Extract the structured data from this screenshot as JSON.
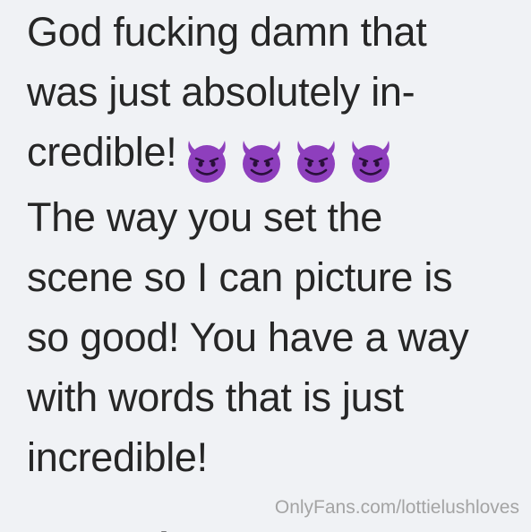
{
  "message": {
    "lines": [
      "God fucking damn that",
      "was just absolutely in-",
      "credible!",
      "The way you set the",
      "scene so I can picture is",
      "so good! You have a way",
      "with words that is just",
      "incredible!"
    ],
    "emojis": [
      "smiling-imp-emoji",
      "smiling-imp-emoji",
      "smiling-imp-emoji",
      "smiling-imp-emoji"
    ],
    "emoji_color": "#8e3fbd"
  },
  "watermark": {
    "text": "OnlyFans.com/lottielushloves"
  },
  "colors": {
    "background": "#f0f2f5",
    "text": "#262626",
    "watermark": "#a4a4a4"
  }
}
